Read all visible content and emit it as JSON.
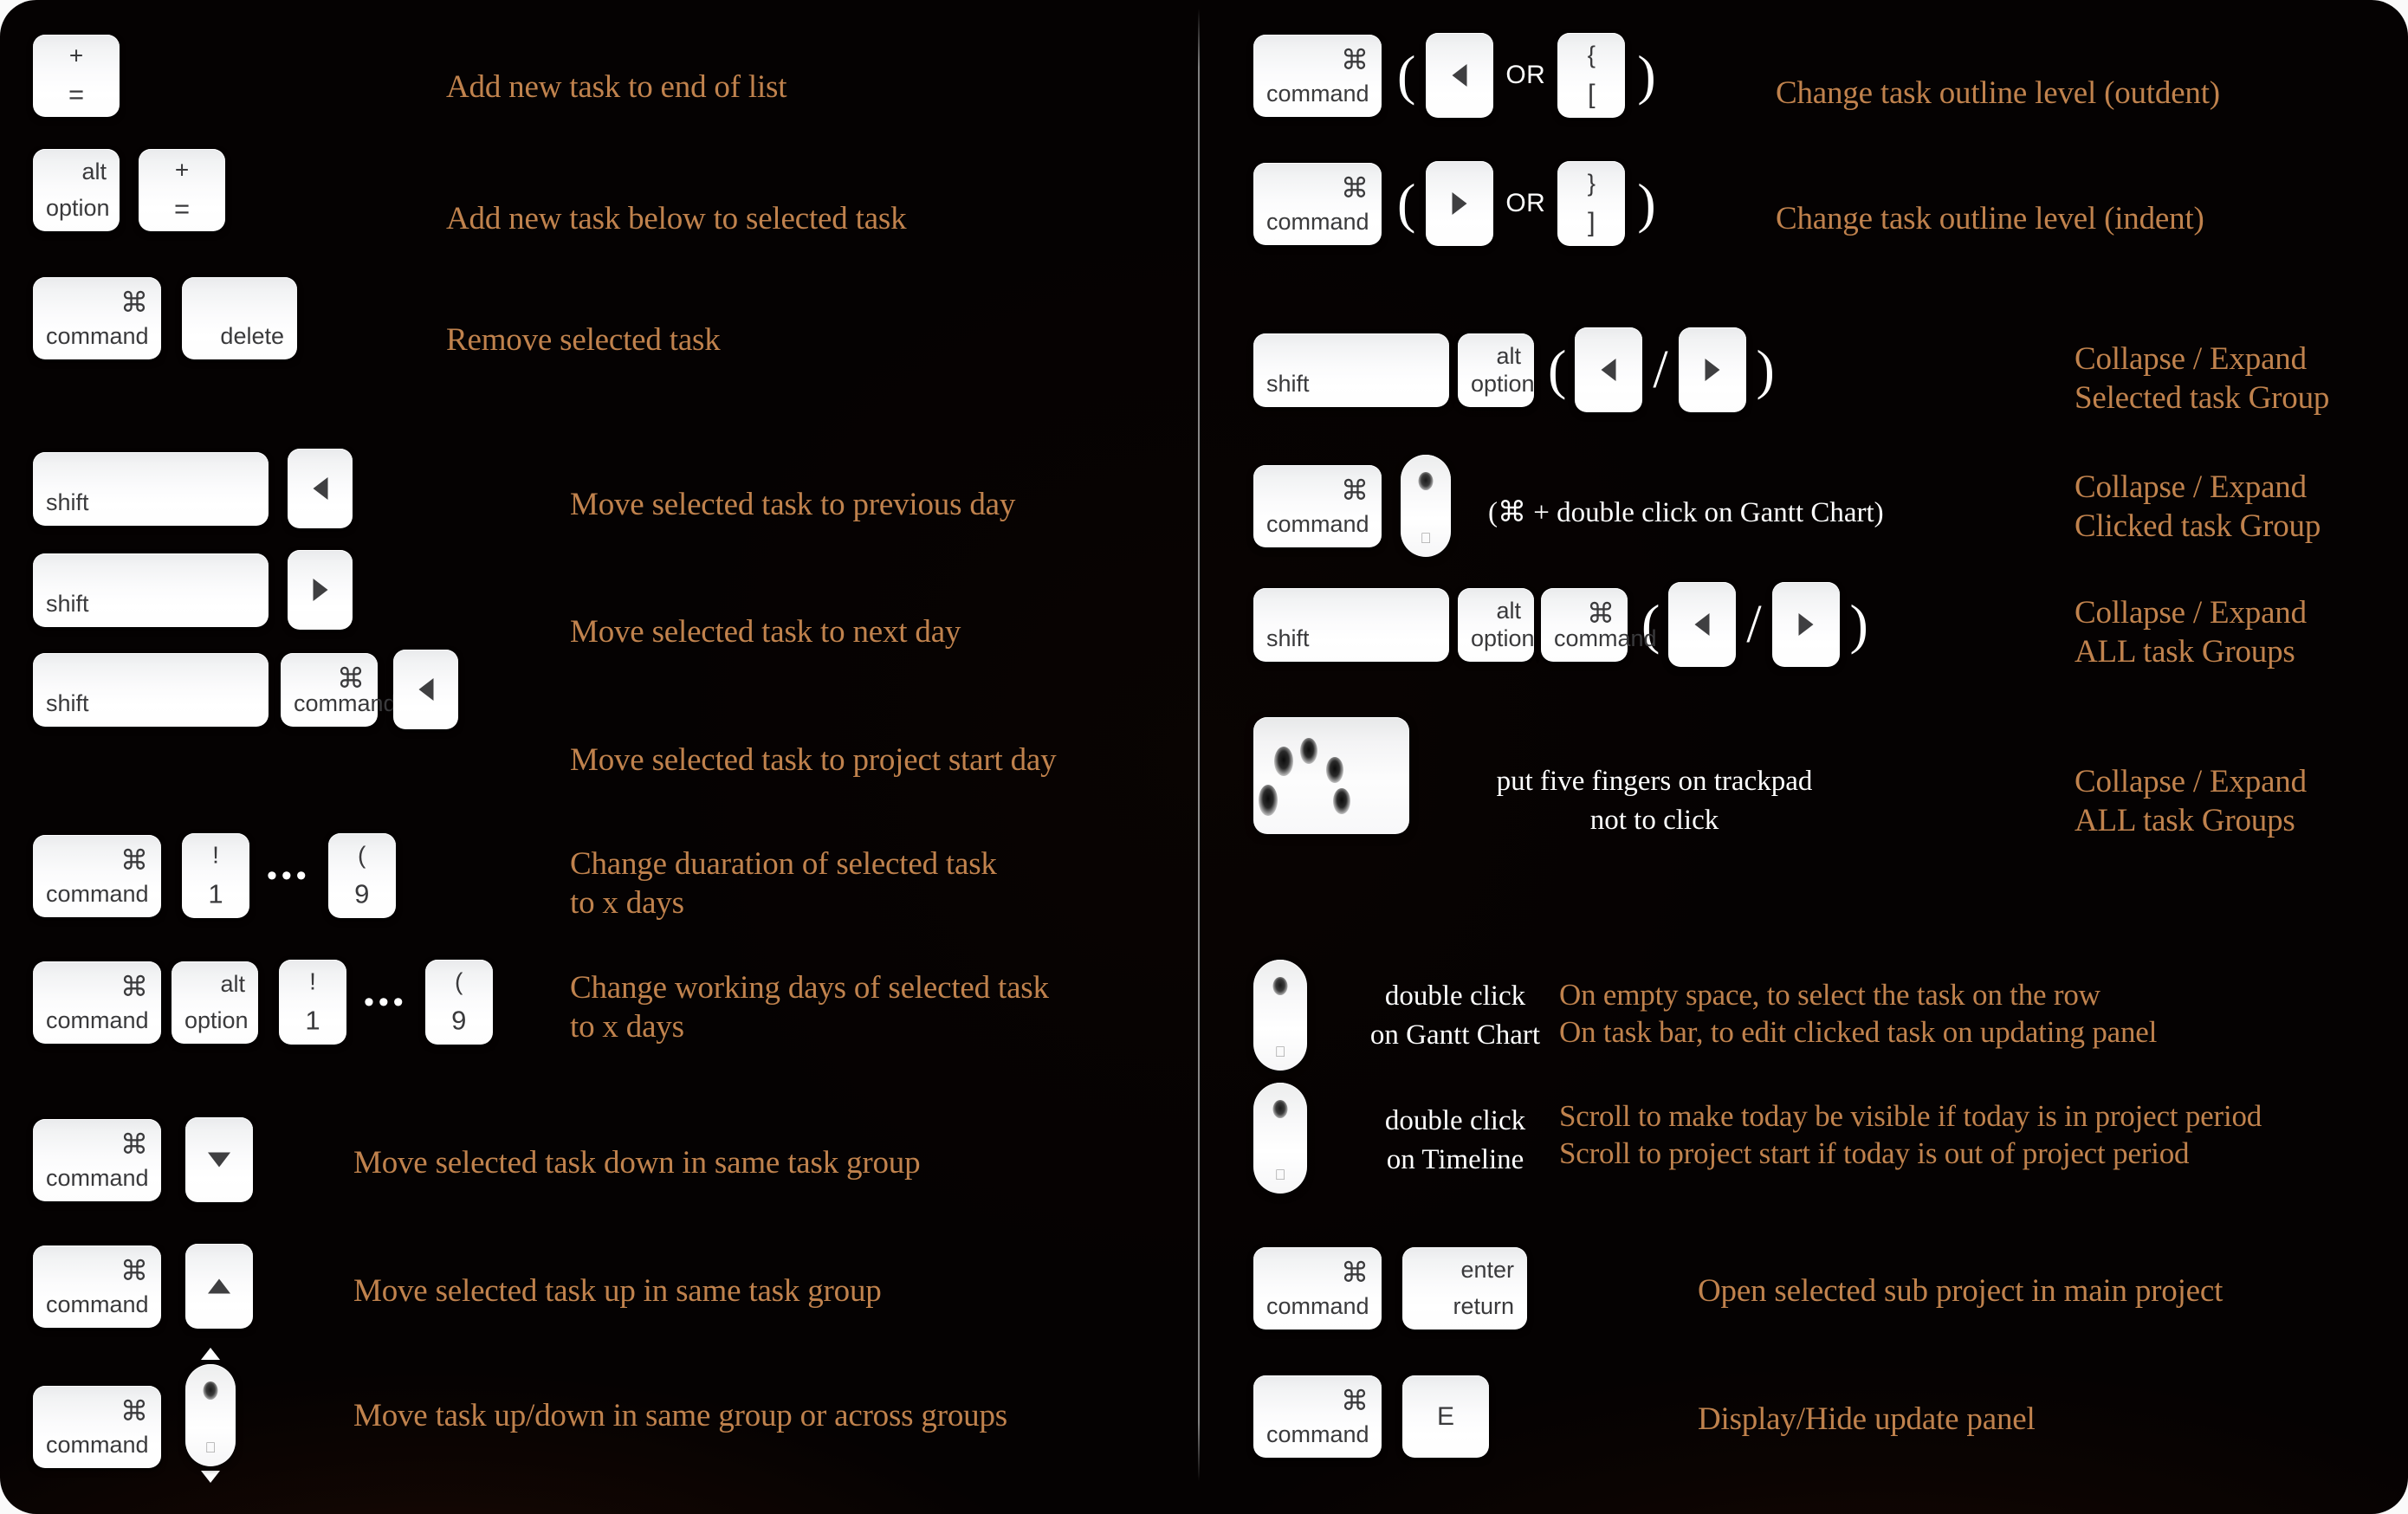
{
  "meta": {
    "accent_text_color": "#c0824d",
    "helper_text_color": "#ffffff",
    "background_color": "#050202",
    "keycap_text_color": "#3a3a3c"
  },
  "glyphs": {
    "command": "⌘",
    "apple": "",
    "arrow_left": "◀",
    "arrow_right": "▶",
    "arrow_up": "▲",
    "arrow_down": "▼",
    "ellipsis": "•••",
    "paren_open": "(",
    "paren_close": ")",
    "slash": "/",
    "or": "OR"
  },
  "left_column": {
    "rows": [
      {
        "id": "add-task-end",
        "keys": [
          {
            "top": "+",
            "bottom": "=",
            "style": "stack"
          }
        ],
        "description": "Add new task to end of list"
      },
      {
        "id": "add-task-below",
        "keys": [
          {
            "top": "alt",
            "bottom": "option",
            "style": "corner"
          },
          {
            "top": "+",
            "bottom": "=",
            "style": "stack"
          }
        ],
        "description": "Add new task below to selected task"
      },
      {
        "id": "remove-task",
        "keys": [
          {
            "symbol": "⌘",
            "bottom": "command",
            "style": "modifier"
          },
          {
            "bottom_right": "delete",
            "style": "label-br"
          }
        ],
        "description": "Remove selected task"
      },
      {
        "id": "move-prev-day",
        "keys": [
          {
            "bottom": "shift",
            "style": "corner-bl"
          },
          {
            "arrow": "left"
          }
        ],
        "description": "Move selected task to previous day"
      },
      {
        "id": "move-next-day",
        "keys": [
          {
            "bottom": "shift",
            "style": "corner-bl"
          },
          {
            "arrow": "right"
          }
        ],
        "description": "Move selected task to next day"
      },
      {
        "id": "move-project-start",
        "keys": [
          {
            "bottom": "shift",
            "style": "corner-bl"
          },
          {
            "symbol": "⌘",
            "bottom": "command",
            "style": "modifier"
          },
          {
            "arrow": "left"
          }
        ],
        "description": "Move selected task to project start day"
      },
      {
        "id": "change-duration",
        "keys": [
          {
            "symbol": "⌘",
            "bottom": "command",
            "style": "modifier"
          },
          {
            "top": "!",
            "bottom": "1",
            "style": "stack"
          },
          {
            "ellipsis": "•••"
          },
          {
            "top": "(",
            "bottom": "9",
            "style": "stack"
          }
        ],
        "description": "Change duaration of selected task\nto x days"
      },
      {
        "id": "change-working-days",
        "keys": [
          {
            "symbol": "⌘",
            "bottom": "command",
            "style": "modifier"
          },
          {
            "top": "alt",
            "bottom": "option",
            "style": "corner"
          },
          {
            "top": "!",
            "bottom": "1",
            "style": "stack"
          },
          {
            "ellipsis": "•••"
          },
          {
            "top": "(",
            "bottom": "9",
            "style": "stack"
          }
        ],
        "description": "Change working days of selected task\nto x days"
      },
      {
        "id": "move-task-down",
        "keys": [
          {
            "symbol": "⌘",
            "bottom": "command",
            "style": "modifier"
          },
          {
            "arrow": "down"
          }
        ],
        "description": "Move selected task down in same task group"
      },
      {
        "id": "move-task-up",
        "keys": [
          {
            "symbol": "⌘",
            "bottom": "command",
            "style": "modifier"
          },
          {
            "arrow": "up"
          }
        ],
        "description": "Move selected task up in same task group"
      },
      {
        "id": "move-task-across",
        "keys": [
          {
            "symbol": "⌘",
            "bottom": "command",
            "style": "modifier"
          },
          {
            "device": "mouse-scroll"
          }
        ],
        "description": "Move task up/down in same group or across groups"
      }
    ]
  },
  "right_column": {
    "rows": [
      {
        "id": "outdent",
        "keys": [
          {
            "symbol": "⌘",
            "bottom": "command",
            "style": "modifier"
          },
          {
            "paren": "("
          },
          {
            "arrow": "left"
          },
          {
            "or": "OR"
          },
          {
            "top": "{",
            "bottom": "[",
            "style": "stack"
          },
          {
            "paren": ")"
          }
        ],
        "description": "Change task outline level (outdent)"
      },
      {
        "id": "indent",
        "keys": [
          {
            "symbol": "⌘",
            "bottom": "command",
            "style": "modifier"
          },
          {
            "paren": "("
          },
          {
            "arrow": "right"
          },
          {
            "or": "OR"
          },
          {
            "top": "}",
            "bottom": "]",
            "style": "stack"
          },
          {
            "paren": ")"
          }
        ],
        "description": "Change task outline level (indent)"
      },
      {
        "id": "collapse-selected-group",
        "keys": [
          {
            "bottom": "shift",
            "style": "corner-bl"
          },
          {
            "top": "alt",
            "bottom": "option",
            "style": "corner"
          },
          {
            "paren": "("
          },
          {
            "arrow": "left"
          },
          {
            "slash": "/"
          },
          {
            "arrow": "right"
          },
          {
            "paren": ")"
          }
        ],
        "description": "Collapse / Expand\nSelected task Group"
      },
      {
        "id": "collapse-clicked-group",
        "keys": [
          {
            "symbol": "⌘",
            "bottom": "command",
            "style": "modifier"
          },
          {
            "device": "mouse"
          }
        ],
        "helper": "(⌘ + double click on Gantt Chart)",
        "description": "Collapse / Expand\nClicked task Group"
      },
      {
        "id": "collapse-all-groups-keys",
        "keys": [
          {
            "bottom": "shift",
            "style": "corner-bl"
          },
          {
            "top": "alt",
            "bottom": "option",
            "style": "corner"
          },
          {
            "symbol": "⌘",
            "bottom": "command",
            "style": "modifier"
          },
          {
            "paren": "("
          },
          {
            "arrow": "left"
          },
          {
            "slash": "/"
          },
          {
            "arrow": "right"
          },
          {
            "paren": ")"
          }
        ],
        "description": "Collapse / Expand\nALL task Groups"
      },
      {
        "id": "collapse-all-groups-trackpad",
        "keys": [
          {
            "device": "trackpad"
          }
        ],
        "helper": "put five fingers on trackpad\nnot to click",
        "description": "Collapse / Expand\nALL task Groups"
      },
      {
        "id": "double-click-gantt",
        "keys": [
          {
            "device": "mouse"
          }
        ],
        "helper": "double click\non Gantt Chart",
        "description": "On empty space, to select the task on the row\nOn task bar,  to edit clicked task on updating panel"
      },
      {
        "id": "double-click-timeline",
        "keys": [
          {
            "device": "mouse"
          }
        ],
        "helper": "double click\non Timeline",
        "description": "Scroll to make today be visible if today is in project period\nScroll to project start if today is out of project period"
      },
      {
        "id": "open-sub-project",
        "keys": [
          {
            "symbol": "⌘",
            "bottom": "command",
            "style": "modifier"
          },
          {
            "top_right": "enter",
            "bottom_right": "return",
            "style": "corner-right"
          }
        ],
        "description": "Open selected sub project in main project"
      },
      {
        "id": "toggle-update-panel",
        "keys": [
          {
            "symbol": "⌘",
            "bottom": "command",
            "style": "modifier"
          },
          {
            "center": "E"
          }
        ],
        "description": "Display/Hide update panel"
      }
    ]
  }
}
